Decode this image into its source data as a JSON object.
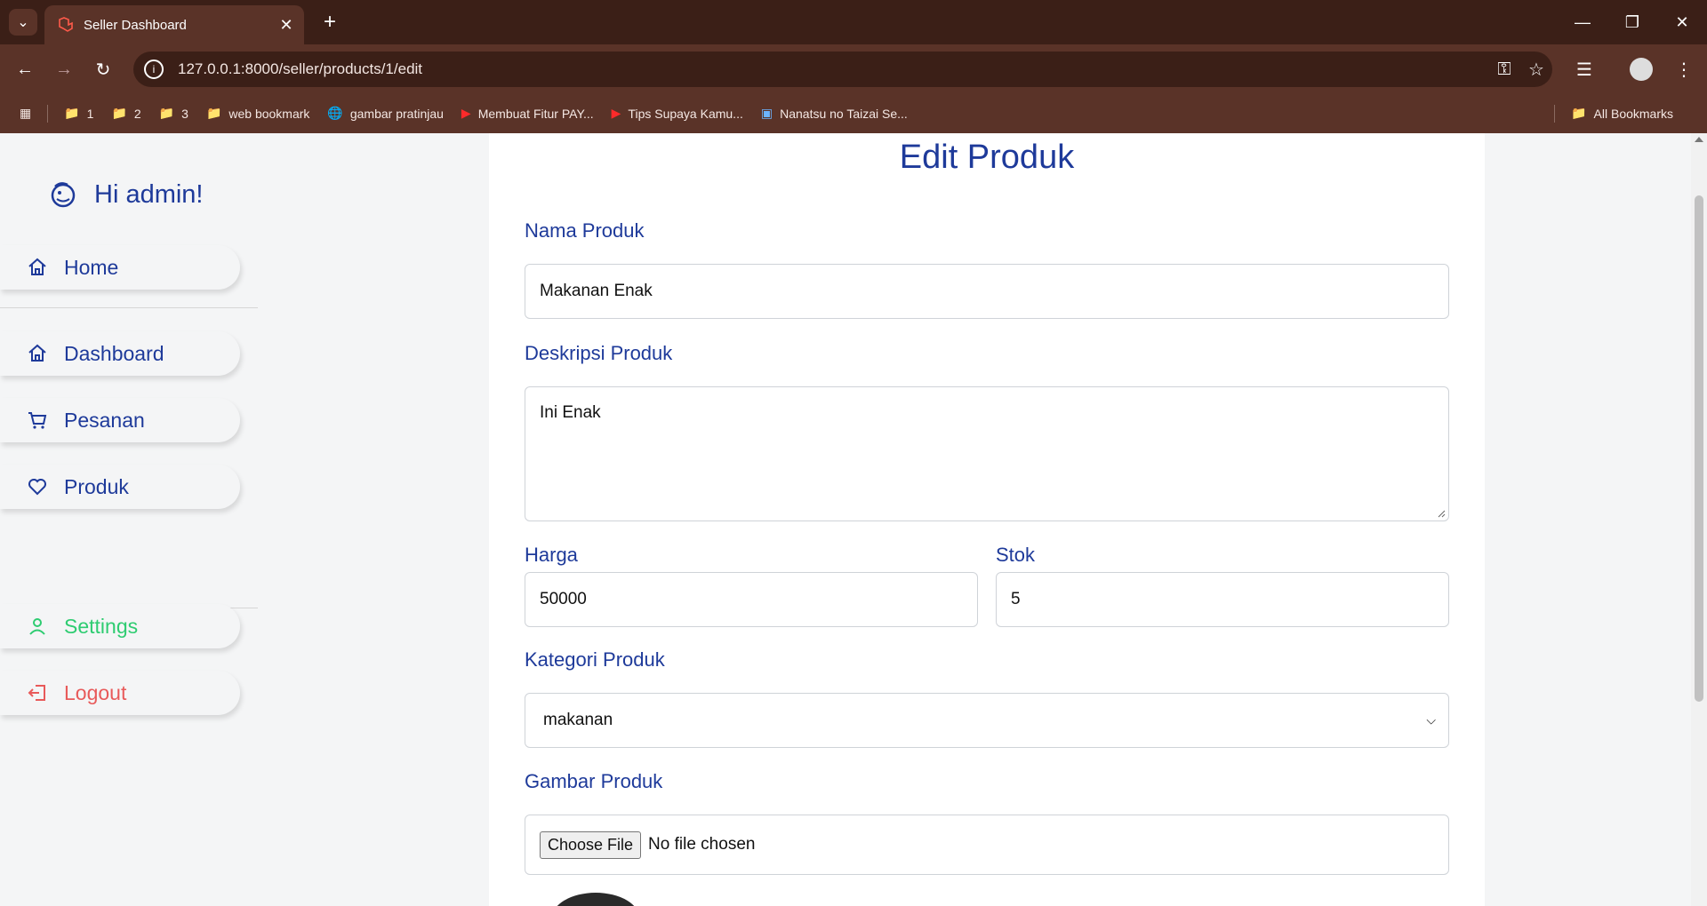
{
  "browser": {
    "tab_title": "Seller Dashboard",
    "url": "127.0.0.1:8000/seller/products/1/edit",
    "bookmarks": [
      "1",
      "2",
      "3",
      "web bookmark",
      "gambar pratinjau",
      "Membuat Fitur PAY...",
      "Tips Supaya Kamu...",
      "Nanatsu no Taizai Se..."
    ],
    "all_bookmarks": "All Bookmarks"
  },
  "sidebar": {
    "greeting": "Hi admin!",
    "items": [
      {
        "label": "Home"
      },
      {
        "label": "Dashboard"
      },
      {
        "label": "Pesanan"
      },
      {
        "label": "Produk"
      },
      {
        "label": "Settings"
      },
      {
        "label": "Logout"
      }
    ]
  },
  "form": {
    "title": "Edit Produk",
    "name_label": "Nama Produk",
    "name_value": "Makanan Enak",
    "desc_label": "Deskripsi Produk",
    "desc_value": "Ini Enak",
    "price_label": "Harga",
    "price_value": "50000",
    "stock_label": "Stok",
    "stock_value": "5",
    "category_label": "Kategori Produk",
    "category_value": "makanan",
    "image_label": "Gambar Produk",
    "choose_file": "Choose File",
    "no_file": "No file chosen"
  },
  "colors": {
    "accent": "#1e3a9a",
    "settings": "#2ecc71",
    "logout": "#e85a5a",
    "chrome": "#5a3328"
  }
}
